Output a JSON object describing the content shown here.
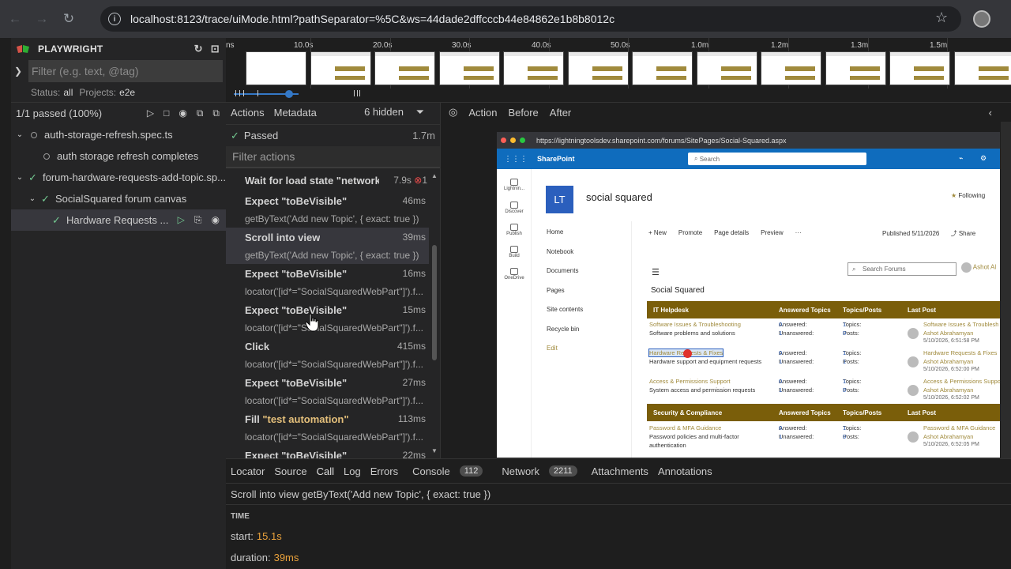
{
  "browser": {
    "url": "localhost:8123/trace/uiMode.html?pathSeparator=%5C&ws=44dade2dffcccb44e84862e1b8b8012c"
  },
  "sidebar": {
    "brand": "PLAYWRIGHT",
    "filter_placeholder": "Filter (e.g. text, @tag)",
    "status_label": "Status:",
    "status_value": "all",
    "projects_label": "Projects:",
    "projects_value": "e2e",
    "passed_summary": "1/1 passed (100%)",
    "tree": [
      {
        "label": "auth-storage-refresh.spec.ts",
        "state": "pending"
      },
      {
        "label": "auth storage refresh completes",
        "state": "pending"
      },
      {
        "label": "forum-hardware-requests-add-topic.sp...",
        "state": "passed"
      },
      {
        "label": "SocialSquared forum canvas",
        "state": "passed"
      },
      {
        "label": "Hardware Requests ...",
        "state": "passed"
      }
    ]
  },
  "timeline": {
    "ticks": [
      "ns",
      "10.0s",
      "20.0s",
      "30.0s",
      "40.0s",
      "50.0s",
      "1.0m",
      "1.2m",
      "1.3m",
      "1.5m"
    ]
  },
  "actions_panel": {
    "tab_actions": "Actions",
    "tab_metadata": "Metadata",
    "hidden_count": "6 hidden",
    "passed_label": "Passed",
    "passed_duration": "1.7m",
    "filter_placeholder": "Filter actions",
    "items": [
      {
        "title": "Wait for load state \"networki...",
        "duration": "7.9s",
        "errors": "1",
        "sub": ""
      },
      {
        "title": "Expect \"toBeVisible\"",
        "duration": "46ms",
        "sub": "getByText('Add new Topic', { exact: true })"
      },
      {
        "title": "Scroll into view",
        "duration": "39ms",
        "sub": "getByText('Add new Topic', { exact: true })"
      },
      {
        "title": "Expect \"toBeVisible\"",
        "duration": "16ms",
        "sub": "locator('[id*=\"SocialSquaredWebPart\"]').f..."
      },
      {
        "title": "Expect \"toBeVisible\"",
        "duration": "15ms",
        "sub": "locator('[id*=\"SocialSquaredWebPart\"]').f..."
      },
      {
        "title": "Click",
        "duration": "415ms",
        "sub": "locator('[id*=\"SocialSquaredWebPart\"]').f..."
      },
      {
        "title": "Expect \"toBeVisible\"",
        "duration": "27ms",
        "sub": "locator('[id*=\"SocialSquaredWebPart\"]').f..."
      },
      {
        "title_prefix": "Fill ",
        "title_highlight": "\"test automation\"",
        "duration": "113ms",
        "sub": "locator('[id*=\"SocialSquaredWebPart\"]').f..."
      },
      {
        "title": "Expect \"toBeVisible\"",
        "duration": "22ms",
        "sub": ""
      }
    ]
  },
  "snapshot_panel": {
    "tab_action": "Action",
    "tab_before": "Before",
    "tab_after": "After",
    "snapshot_url": "https://lightningtoolsdev.sharepoint.com/forums/SitePages/Social-Squared.aspx",
    "sp": {
      "app_name": "SharePoint",
      "search_placeholder": "Search",
      "rail": [
        "Lightnin...",
        "Discover",
        "Publish",
        "Build",
        "OneDrive"
      ],
      "site_initials": "LT",
      "site_name": "social squared",
      "following": "Following",
      "nav": [
        "Home",
        "Notebook",
        "Documents",
        "Pages",
        "Site contents",
        "Recycle bin",
        "Edit"
      ],
      "commands": [
        "+ New",
        "Promote",
        "Page details",
        "Preview",
        "···"
      ],
      "published": "Published 5/11/2026",
      "share": "Share",
      "forum_search": "Search Forums",
      "user": "Ashot Al",
      "heading": "Social Squared",
      "sections": [
        {
          "title": "IT Helpdesk",
          "col_answered": "Answered Topics",
          "col_topics": "Topics/Posts",
          "col_last": "Last Post",
          "rows": [
            {
              "name": "Software Issues & Troubleshooting",
              "desc": "Software problems and solutions",
              "answered": "Answered: ",
              "answered_n": "0",
              "unanswered": "Unanswered: ",
              "unanswered_n": "1",
              "topics": "Topics: ",
              "topics_n": "1",
              "posts": "Posts: ",
              "posts_n": "0",
              "last_title": "Software Issues & Troublesh",
              "last_user": "Ashot Abrahamyan",
              "last_time": "5/10/2026, 6:51:58 PM"
            },
            {
              "name": "Hardware Requests & Fixes",
              "desc": "Hardware support and equipment requests",
              "answered": "Answered: ",
              "answered_n": "0",
              "unanswered": "Unanswered: ",
              "unanswered_n": "1",
              "topics": "Topics: ",
              "topics_n": "1",
              "posts": "Posts: ",
              "posts_n": "1",
              "last_title": "Hardware Requests & Fixes",
              "last_user": "Ashot Abrahamyan",
              "last_time": "5/10/2026, 6:52:00 PM"
            },
            {
              "name": "Access & Permissions Support",
              "desc": "System access and permission requests",
              "answered": "Answered: ",
              "answered_n": "0",
              "unanswered": "Unanswered: ",
              "unanswered_n": "1",
              "topics": "Topics: ",
              "topics_n": "1",
              "posts": "Posts: ",
              "posts_n": "0",
              "last_title": "Access & Permissions Suppo",
              "last_user": "Ashot Abrahamyan",
              "last_time": "5/10/2026, 6:52:02 PM"
            }
          ]
        },
        {
          "title": "Security & Compliance",
          "col_answered": "Answered Topics",
          "col_topics": "Topics/Posts",
          "col_last": "Last Post",
          "rows": [
            {
              "name": "Password & MFA Guidance",
              "desc": "Password policies and multi-factor",
              "desc2": "authentication",
              "answered": "Answered: ",
              "answered_n": "0",
              "unanswered": "Unanswered: ",
              "unanswered_n": "1",
              "topics": "Topics: ",
              "topics_n": "1",
              "posts": "Posts: ",
              "posts_n": "0",
              "last_title": "Password & MFA Guidance",
              "last_user": "Ashot Abrahamyan",
              "last_time": "5/10/2026, 6:52:05 PM"
            }
          ]
        }
      ]
    }
  },
  "bottom_panel": {
    "tabs": [
      "Locator",
      "Source",
      "Call",
      "Log",
      "Errors",
      "Console",
      "Network",
      "Attachments",
      "Annotations"
    ],
    "console_count": "112",
    "network_count": "2211",
    "call_text": "Scroll into view getByText('Add new Topic', { exact: true })",
    "time_header": "TIME",
    "start_label": "start:",
    "start_value": "15.1s",
    "duration_label": "duration:",
    "duration_value": "39ms"
  }
}
